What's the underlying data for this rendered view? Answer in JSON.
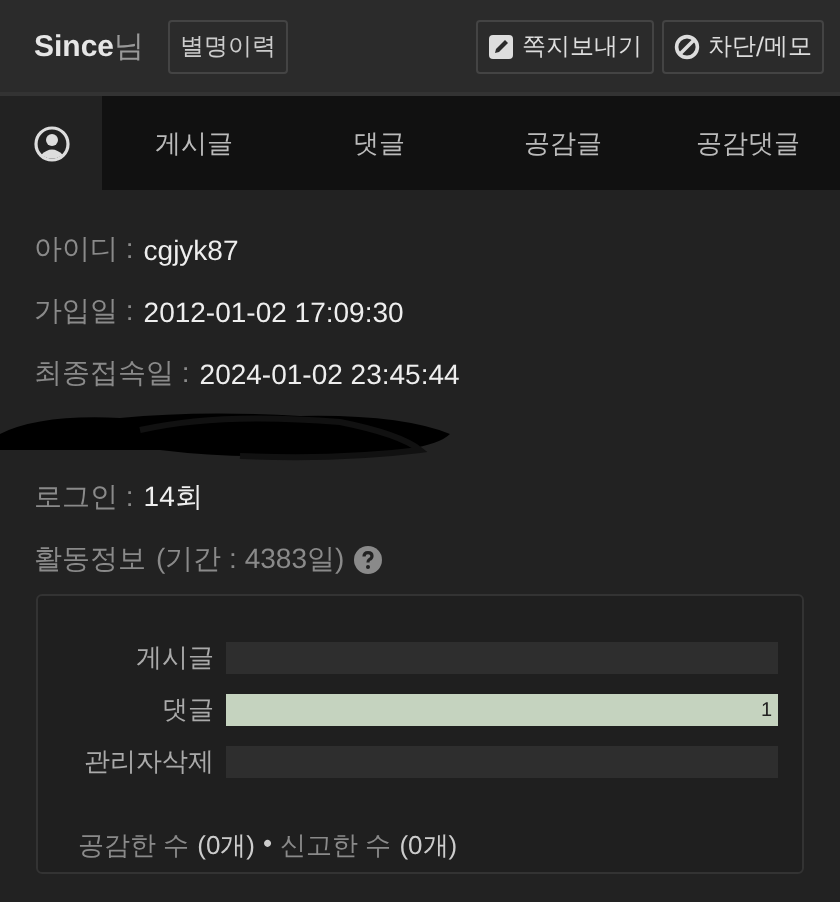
{
  "header": {
    "nickname": "Since",
    "suffix": "님",
    "history_button": "별명이력",
    "actions": [
      {
        "kind": "message",
        "label": "쪽지보내기"
      },
      {
        "kind": "block",
        "label": "차단/메모"
      }
    ]
  },
  "tabs": [
    {
      "kind": "icon",
      "selected": true
    },
    {
      "kind": "text",
      "label": "게시글",
      "selected": false
    },
    {
      "kind": "text",
      "label": "댓글",
      "selected": false
    },
    {
      "kind": "text",
      "label": "공감글",
      "selected": false
    },
    {
      "kind": "text",
      "label": "공감댓글",
      "selected": false
    }
  ],
  "info": [
    {
      "kind": "field",
      "label": "아이디 :",
      "value": "cgjyk87"
    },
    {
      "kind": "field",
      "label": "가입일 :",
      "value": "2012-01-02 17:09:30"
    },
    {
      "kind": "field",
      "label": "최종접속일 :",
      "value": "2024-01-02 23:45:44"
    },
    {
      "kind": "redacted"
    },
    {
      "kind": "field",
      "label": "로그인 :",
      "value": "14회"
    }
  ],
  "activity": {
    "title": "활동정보",
    "period": "(기간 : 4383일)",
    "bars": [
      {
        "label": "게시글",
        "level": 0
      },
      {
        "label": "댓글",
        "level": 1,
        "value": "1"
      },
      {
        "label": "관리자삭제",
        "level": 0
      }
    ],
    "summary": [
      {
        "label": "공감한 수",
        "count": "(0개)"
      },
      {
        "label": "신고한 수",
        "count": "(0개)"
      }
    ],
    "separator": "•"
  }
}
